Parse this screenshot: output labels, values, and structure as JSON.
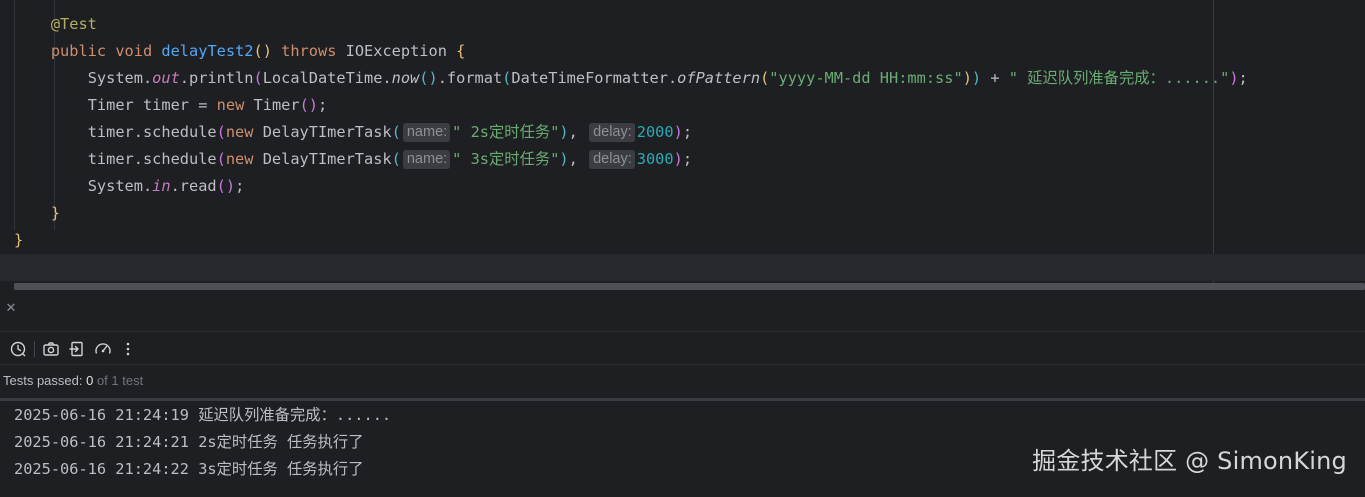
{
  "editor": {
    "annotation": "@Test",
    "method": {
      "modifier": "public",
      "return_type": "void",
      "name": "delayTest2",
      "throws_keyword": "throws",
      "exception": "IOException"
    },
    "println": {
      "receiver": "System.",
      "field": "out",
      "call": ".println",
      "class": "LocalDateTime.",
      "now": "now",
      "format": ".format",
      "formatter": "DateTimeFormatter.",
      "of_pattern": "ofPattern",
      "pattern": "\"yyyy-MM-dd HH:mm:ss\"",
      "plus": " + ",
      "message": "\" 延迟队列准备完成：......\""
    },
    "timer_decl": {
      "type": "Timer",
      "var": "timer",
      "eq": " = ",
      "new_kw": "new",
      "ctor": "Timer"
    },
    "schedules": [
      {
        "call": "timer.schedule",
        "new_kw": "new",
        "task_class": "DelayTImerTask",
        "hint_name": "name:",
        "task_name": "\" 2s定时任务\"",
        "hint_delay": "delay:",
        "delay": "2000"
      },
      {
        "call": "timer.schedule",
        "new_kw": "new",
        "task_class": "DelayTImerTask",
        "hint_name": "name:",
        "task_name": "\" 3s定时任务\"",
        "hint_delay": "delay:",
        "delay": "3000"
      }
    ],
    "read_line": {
      "receiver": "System.",
      "field": "in",
      "call": ".read"
    }
  },
  "toolbar": {
    "icons": [
      "history-icon",
      "camera-icon",
      "export-icon",
      "gauge-icon",
      "more-vertical-icon"
    ]
  },
  "status": {
    "label": "Tests passed: ",
    "passed": "0",
    "total_text": " of 1 test"
  },
  "output": {
    "lines": [
      "2025-06-16 21:24:19 延迟队列准备完成：......",
      "2025-06-16 21:24:21 2s定时任务 任务执行了",
      "2025-06-16 21:24:22 3s定时任务 任务执行了"
    ]
  },
  "watermark": "掘金技术社区 @ SimonKing",
  "colors": {
    "background": "#1e1f22",
    "keyword": "#cf8e6d",
    "string": "#6aab73",
    "number": "#2aacb8",
    "method": "#56a8f5",
    "annotation": "#b3ae60",
    "static_field": "#c77dbb"
  }
}
